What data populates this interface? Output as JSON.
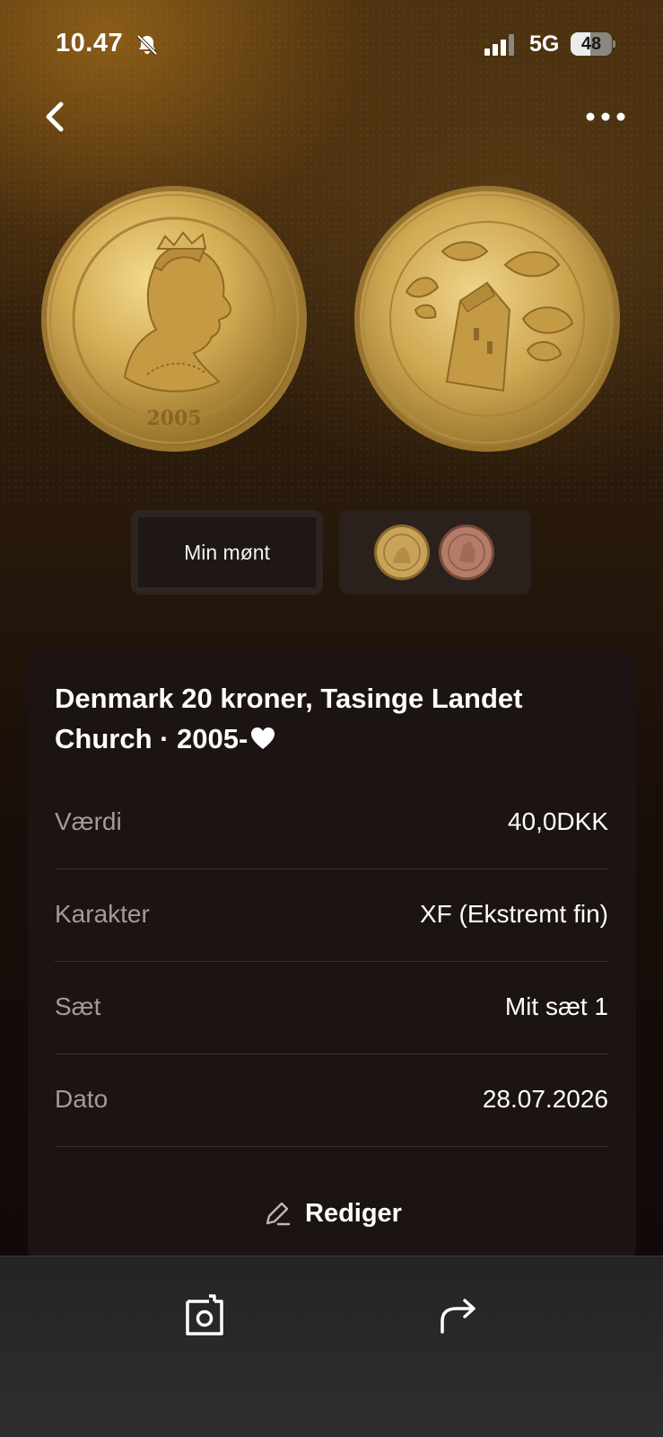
{
  "status_bar": {
    "time": "10.47",
    "network": "5G",
    "battery": "48",
    "icons": [
      "bell-muted-icon",
      "signal-icon"
    ]
  },
  "nav": {
    "icons": [
      "chevron-left-icon",
      "more-horizontal-icon"
    ]
  },
  "coin_images": {
    "obverse": "coin obverse",
    "reverse": "coin reverse"
  },
  "thumbnails": {
    "mine_label": "Min mønt"
  },
  "coin": {
    "title": "Denmark 20 kroner, Tasinge Landet Church · 2005-",
    "favorite_icon": "heart-icon"
  },
  "details": [
    {
      "label": "Værdi",
      "value": "40,0DKK"
    },
    {
      "label": "Karakter",
      "value": "XF (Ekstremt fin)"
    },
    {
      "label": "Sæt",
      "value": "Mit sæt 1"
    },
    {
      "label": "Dato",
      "value": "28.07.2026"
    }
  ],
  "actions": {
    "edit_label": "Rediger",
    "edit_icon": "pencil-icon"
  },
  "bottom_bar": {
    "icons": [
      "photo-icon",
      "share-icon"
    ]
  },
  "colors": {
    "background": "#120b09",
    "card": "#1c1412",
    "coin_gold": "#d8b25a",
    "label_gray": "#a39b97"
  }
}
